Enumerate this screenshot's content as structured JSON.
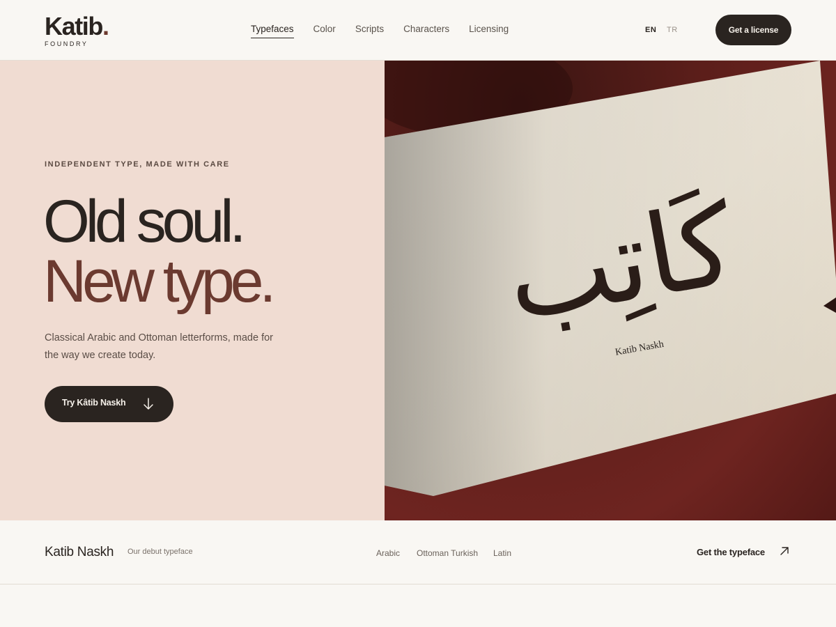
{
  "brand": {
    "name": "Katib",
    "dot": ".",
    "tagline": "FOUNDRY"
  },
  "nav": [
    {
      "label": "Typefaces",
      "active": true
    },
    {
      "label": "Color"
    },
    {
      "label": "Scripts"
    },
    {
      "label": "Characters"
    },
    {
      "label": "Licensing"
    }
  ],
  "lang": {
    "en": "EN",
    "tr": "TR",
    "active": "EN"
  },
  "header_cta": "Get a license",
  "hero": {
    "eyebrow": "INDEPENDENT TYPE, MADE WITH CARE",
    "line1": "Old soul.",
    "line2": "New type.",
    "description": "Classical Arabic and Ottoman letterforms, made for the way we create today.",
    "button": "Try Kâtib Naskh",
    "button_icon": "arrow-down-icon",
    "image": {
      "arabic": "كَاتِب",
      "caption": "Katib Naskh"
    }
  },
  "strip": {
    "title": "Katib Naskh",
    "subtitle": "Our debut typeface",
    "scripts": [
      "Arabic",
      "Ottoman Turkish",
      "Latin"
    ],
    "cta": "Get the typeface",
    "cta_icon": "arrow-up-right-icon"
  },
  "colors": {
    "ink": "#2a2420",
    "accent": "#6b3a30",
    "hero_bg": "#f0dcd2",
    "page_bg": "#f9f7f3",
    "burgundy": "#6e2420"
  }
}
